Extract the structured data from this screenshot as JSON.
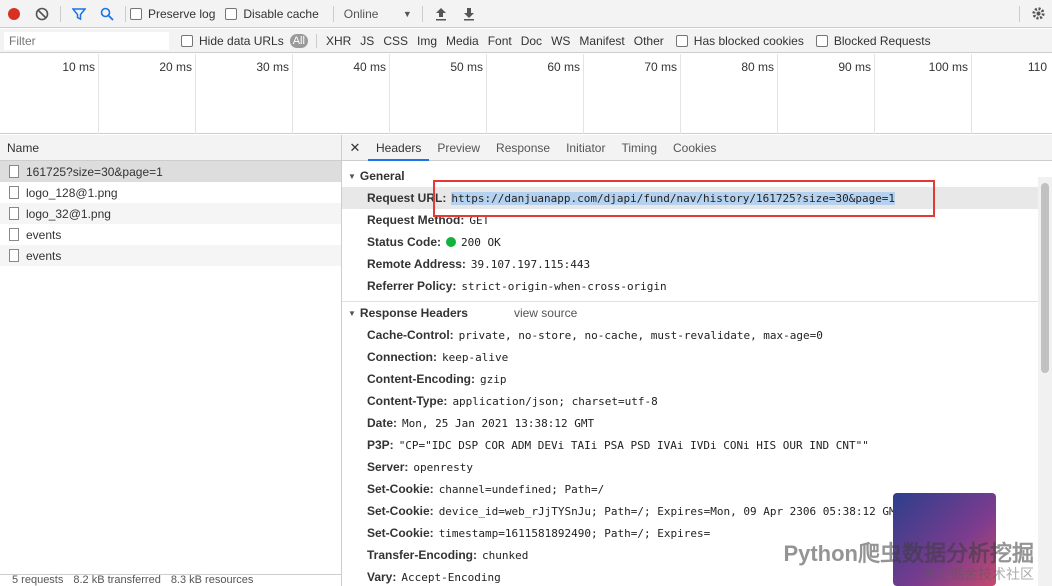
{
  "toolbar": {
    "preserve_log": "Preserve log",
    "disable_cache": "Disable cache",
    "throttle": "Online"
  },
  "filterbar": {
    "filter_placeholder": "Filter",
    "hide_data_urls": "Hide data URLs",
    "types": [
      "All",
      "XHR",
      "JS",
      "CSS",
      "Img",
      "Media",
      "Font",
      "Doc",
      "WS",
      "Manifest",
      "Other"
    ],
    "has_blocked_cookies": "Has blocked cookies",
    "blocked_requests": "Blocked Requests"
  },
  "timeline": {
    "ticks": [
      "10 ms",
      "20 ms",
      "30 ms",
      "40 ms",
      "50 ms",
      "60 ms",
      "70 ms",
      "80 ms",
      "90 ms",
      "100 ms",
      "110"
    ]
  },
  "requests": {
    "header": "Name",
    "items": [
      "161725?size=30&page=1",
      "logo_128@1.png",
      "logo_32@1.png",
      "events",
      "events"
    ],
    "status": [
      "5 requests",
      "8.2 kB transferred",
      "8.3 kB resources"
    ]
  },
  "details": {
    "tabs": [
      "Headers",
      "Preview",
      "Response",
      "Initiator",
      "Timing",
      "Cookies"
    ],
    "general": {
      "title": "General",
      "rows": [
        {
          "k": "Request URL:",
          "v": "https://danjuanapp.com/djapi/fund/nav/history/161725?size=30&page=1"
        },
        {
          "k": "Request Method:",
          "v": "GET"
        },
        {
          "k": "Status Code:",
          "v": "200 OK"
        },
        {
          "k": "Remote Address:",
          "v": "39.107.197.115:443"
        },
        {
          "k": "Referrer Policy:",
          "v": "strict-origin-when-cross-origin"
        }
      ]
    },
    "response": {
      "title": "Response Headers",
      "view_source": "view source",
      "rows": [
        {
          "k": "Cache-Control:",
          "v": "private, no-store, no-cache, must-revalidate, max-age=0"
        },
        {
          "k": "Connection:",
          "v": "keep-alive"
        },
        {
          "k": "Content-Encoding:",
          "v": "gzip"
        },
        {
          "k": "Content-Type:",
          "v": "application/json; charset=utf-8"
        },
        {
          "k": "Date:",
          "v": "Mon, 25 Jan 2021 13:38:12 GMT"
        },
        {
          "k": "P3P:",
          "v": "\"CP=\"IDC DSP COR ADM DEVi TAIi PSA PSD IVAi IVDi CONi HIS OUR IND CNT\"\""
        },
        {
          "k": "Server:",
          "v": "openresty"
        },
        {
          "k": "Set-Cookie:",
          "v": "channel=undefined; Path=/"
        },
        {
          "k": "Set-Cookie:",
          "v": "device_id=web_rJjTYSnJu; Path=/; Expires=Mon, 09 Apr 2306 05:38:12 GMT"
        },
        {
          "k": "Set-Cookie:",
          "v": "timestamp=1611581892490; Path=/; Expires="
        },
        {
          "k": "Transfer-Encoding:",
          "v": "chunked"
        },
        {
          "k": "Vary:",
          "v": "Accept-Encoding"
        }
      ]
    }
  },
  "watermark": {
    "line1": "Python爬虫数据分析挖掘",
    "line2": "稀土掘金技术社区"
  }
}
